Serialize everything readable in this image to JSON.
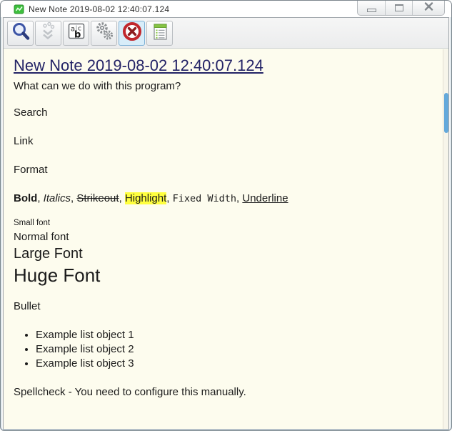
{
  "window": {
    "title": "New Note 2019-08-02 12:40:07.124",
    "icon": "app-note-icon",
    "controls": [
      {
        "name": "minimize",
        "icon": "minimize-icon"
      },
      {
        "name": "maximize",
        "icon": "maximize-icon"
      },
      {
        "name": "close",
        "icon": "close-icon"
      }
    ]
  },
  "toolbar": {
    "buttons": [
      {
        "id": "search",
        "icon": "search-icon",
        "state": "normal"
      },
      {
        "id": "import",
        "icon": "import-icon",
        "state": "disabled"
      },
      {
        "id": "find-replace",
        "icon": "abc-letters-icon",
        "state": "normal"
      },
      {
        "id": "settings",
        "icon": "gears-icon",
        "state": "normal"
      },
      {
        "id": "delete-note",
        "icon": "cancel-icon",
        "state": "active"
      },
      {
        "id": "note-list",
        "icon": "note-list-icon",
        "state": "normal"
      }
    ]
  },
  "note": {
    "heading": "New Note 2019-08-02 12:40:07.124",
    "intro": "What can we do with this program?",
    "search_label": "Search",
    "link_label": "Link",
    "format_label": "Format",
    "format_demo": {
      "bold": "Bold",
      "sep1": ", ",
      "italics": "Italics",
      "sep2": ", ",
      "strikeout": "Strikeout",
      "sep3": ", ",
      "highlight": "Highlight",
      "sep4": ", ",
      "fixed_width": "Fixed Width",
      "sep5": ", ",
      "underline": "Underline"
    },
    "font_sizes": {
      "small": "Small font",
      "normal": "Normal font",
      "large": "Large Font",
      "huge": "Huge Font"
    },
    "bullet_label": "Bullet",
    "bullets": [
      "Example list object 1",
      "Example list object 2",
      "Example list object 3"
    ],
    "spellcheck": "Spellcheck - You need to configure this manually."
  },
  "colors": {
    "heading_link": "#232366",
    "highlight_bg": "#ffff3f",
    "content_bg": "#fdfcee",
    "scrollbar_thumb": "#64a9db",
    "active_button_bg": "#d8edf9",
    "cancel_icon_red": "#c1272d",
    "app_icon_green": "#3dbf3d"
  }
}
